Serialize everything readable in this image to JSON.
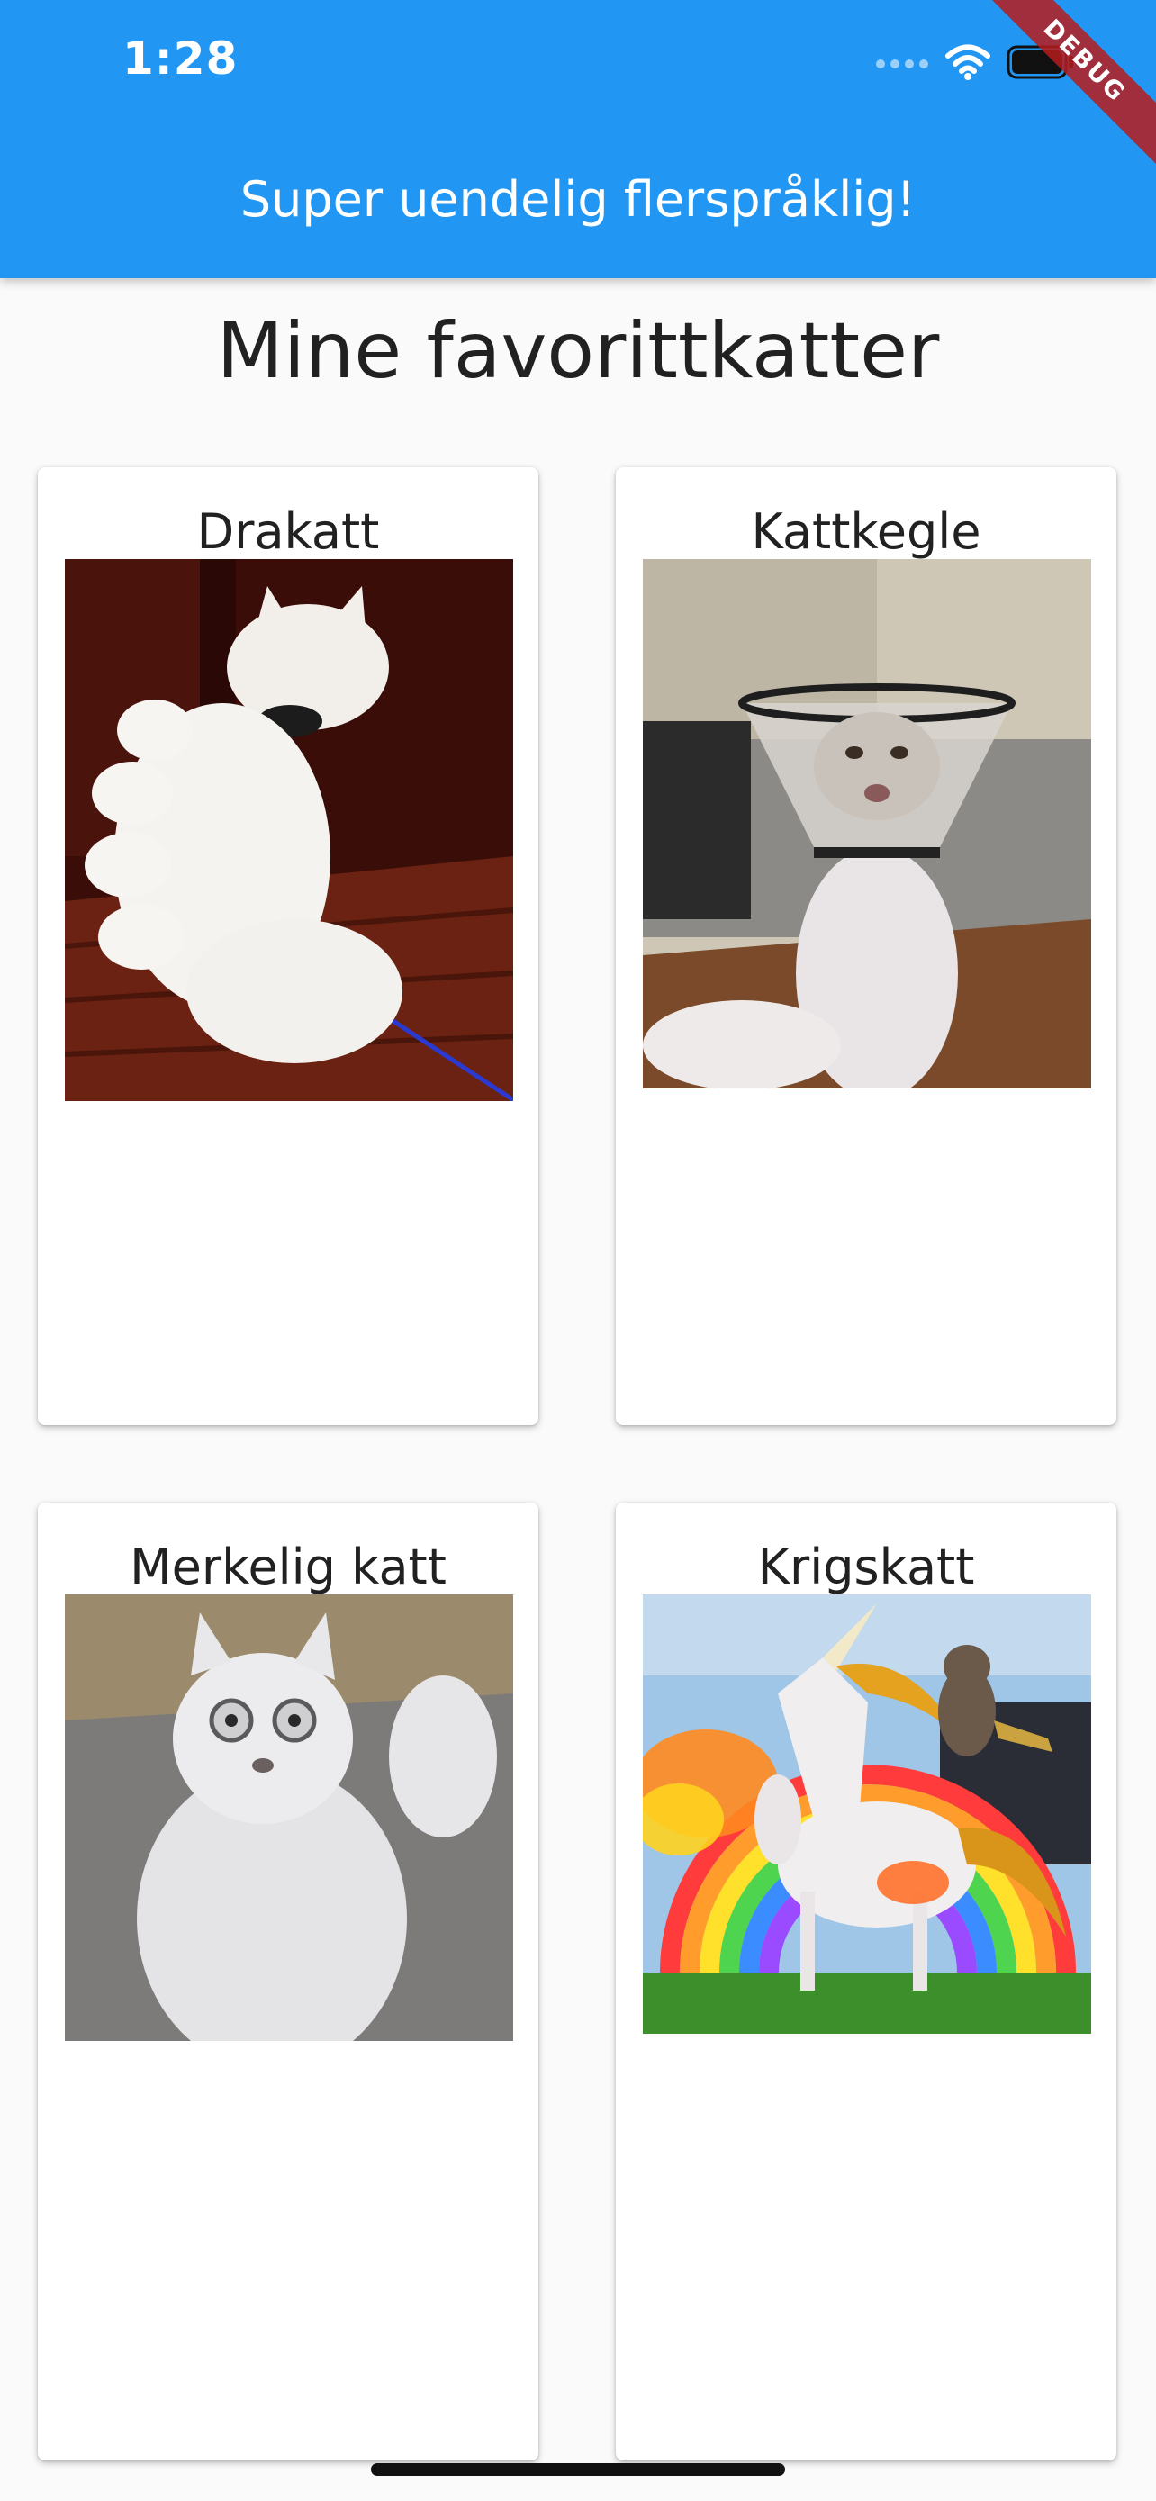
{
  "status_bar": {
    "time": "1:28",
    "icons": [
      "cellular-dots-icon",
      "wifi-icon",
      "battery-icon"
    ]
  },
  "app_bar": {
    "title": "Super uendelig flerspråklig!",
    "color": "#2196f3"
  },
  "debug_banner": {
    "label": "DEBUG"
  },
  "page": {
    "heading": "Mine favorittkatter"
  },
  "cats": [
    {
      "name": "Drakatt"
    },
    {
      "name": "Kattkegle"
    },
    {
      "name": "Merkelig katt"
    },
    {
      "name": "Krigskatt"
    }
  ]
}
